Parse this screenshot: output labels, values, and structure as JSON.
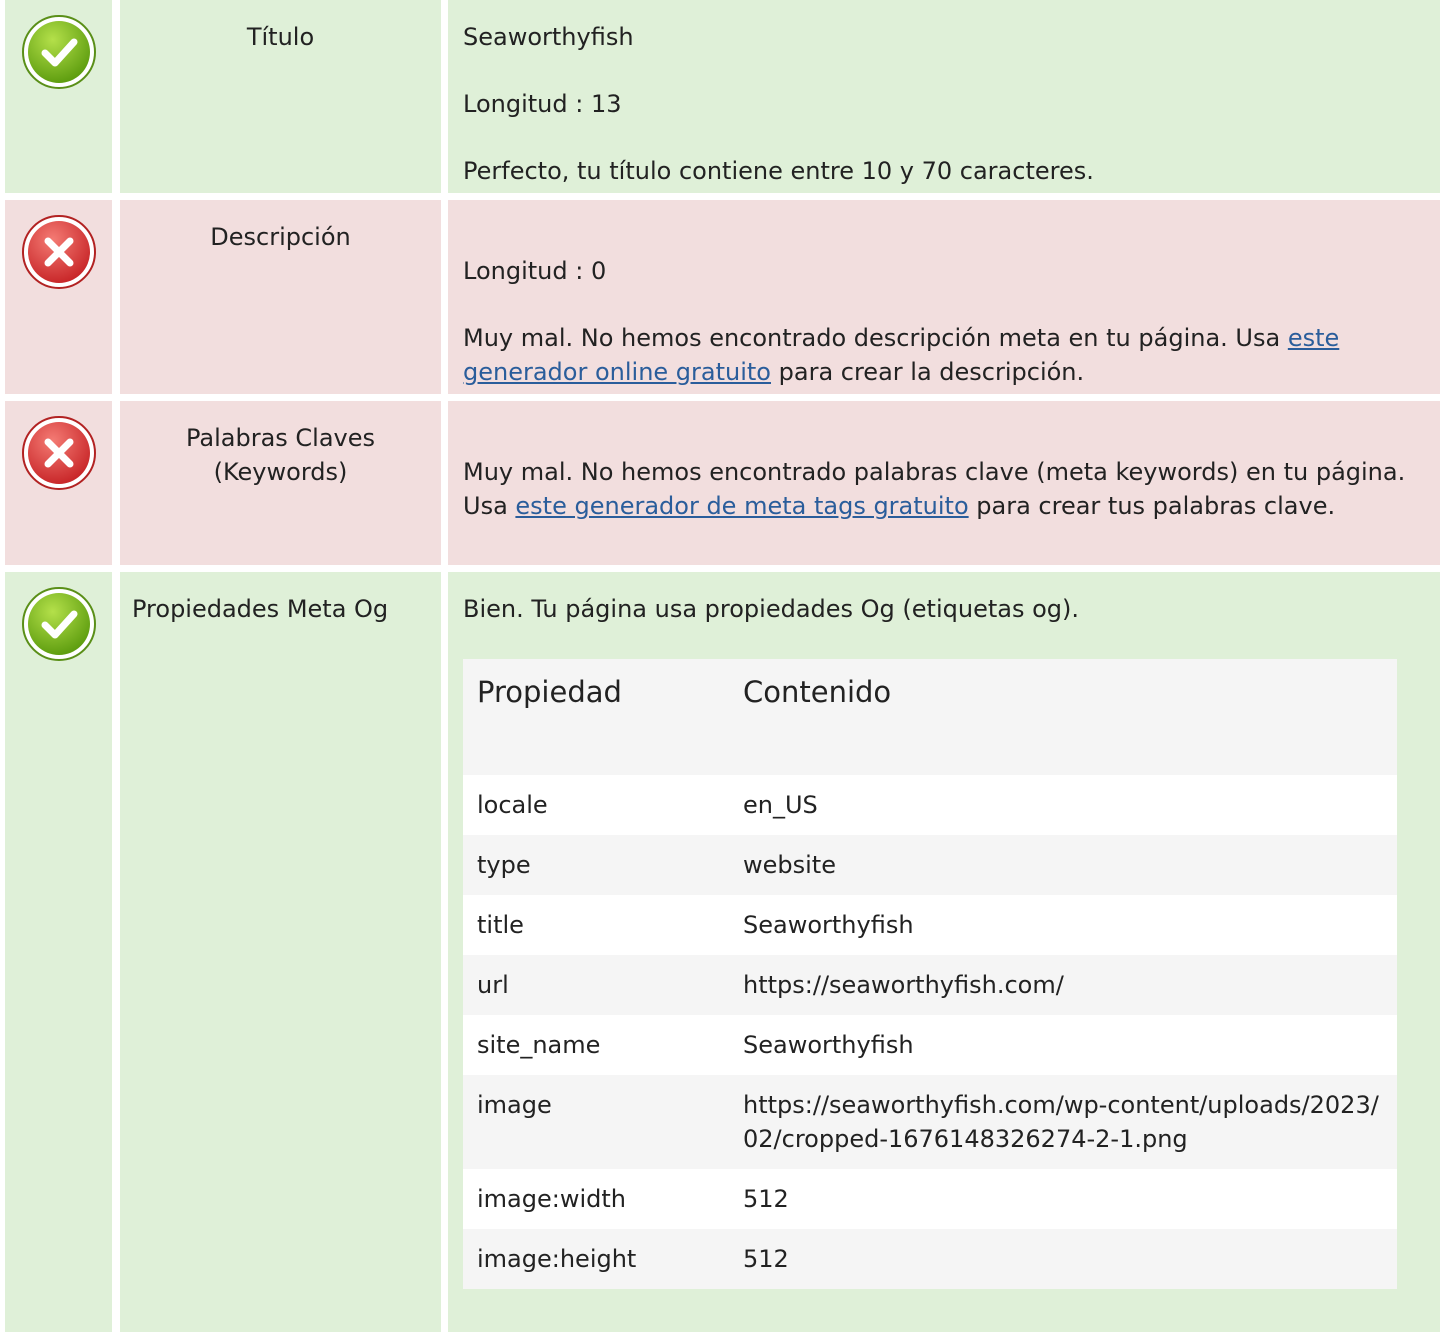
{
  "rows": {
    "title": {
      "label": "Título",
      "value": "Seaworthyfish",
      "length": "Longitud : 13",
      "message": "Perfecto, tu título contiene entre 10 y 70 caracteres."
    },
    "description": {
      "label": "Descripción",
      "length": "Longitud : 0",
      "message_before": "Muy mal. No hemos encontrado descripción meta en tu página. Usa ",
      "link": "este generador online gratuito",
      "message_after": " para crear la descripción."
    },
    "keywords": {
      "label": "Palabras Claves (Keywords)",
      "message_before": "Muy mal. No hemos encontrado palabras clave (meta keywords) en tu página. Usa ",
      "link": "este generador de meta tags gratuito",
      "message_after": " para crear tus palabras clave."
    },
    "og": {
      "label": "Propiedades Meta Og",
      "message": "Bien. Tu página usa propiedades Og (etiquetas og).",
      "table": {
        "header_property": "Propiedad",
        "header_content": "Contenido",
        "rows": [
          {
            "property": "locale",
            "content": "en_US"
          },
          {
            "property": "type",
            "content": "website"
          },
          {
            "property": "title",
            "content": "Seaworthyfish"
          },
          {
            "property": "url",
            "content": "https://seaworthyfish.com/"
          },
          {
            "property": "site_name",
            "content": "Seaworthyfish"
          },
          {
            "property": "image",
            "content": "https://seaworthyfish.com/wp-content/uploads/2023/02/cropped-1676148326274-2-1.png"
          },
          {
            "property": "image:width",
            "content": "512"
          },
          {
            "property": "image:height",
            "content": "512"
          }
        ]
      }
    }
  },
  "colors": {
    "ok_bg": "#dff0d8",
    "bad_bg": "#f2dede",
    "link": "#2a5d9b"
  },
  "icons": {
    "ok": "check-circle-icon",
    "bad": "x-circle-icon"
  }
}
